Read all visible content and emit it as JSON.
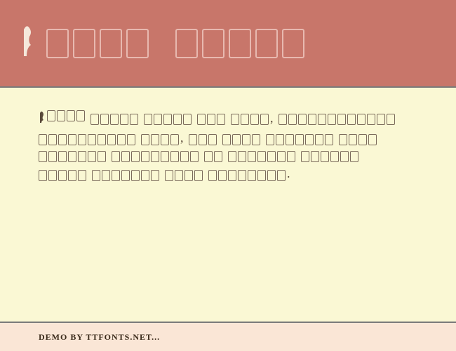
{
  "header": {
    "word1_boxes": 4,
    "word2_boxes": 5
  },
  "content": {
    "lines": [
      [
        {
          "g": true,
          "n": 4
        },
        {
          "n": 5
        },
        {
          "n": 5
        },
        {
          "n": 3
        },
        {
          "n": 4
        },
        {
          "p": ","
        },
        {
          "n": 12
        }
      ],
      [
        {
          "n": 10
        },
        {
          "n": 4
        },
        {
          "p": ","
        },
        {
          "n": 3
        },
        {
          "n": 4
        },
        {
          "n": 7
        },
        {
          "n": 4
        }
      ],
      [
        {
          "n": 7
        },
        {
          "n": 9
        },
        {
          "n": 2
        },
        {
          "n": 7
        },
        {
          "n": 6
        }
      ],
      [
        {
          "n": 5
        },
        {
          "n": 7
        },
        {
          "n": 4
        },
        {
          "n": 8
        },
        {
          "p": "."
        }
      ]
    ]
  },
  "footer": {
    "text": "DEMO BY TTFONTS.NET..."
  }
}
